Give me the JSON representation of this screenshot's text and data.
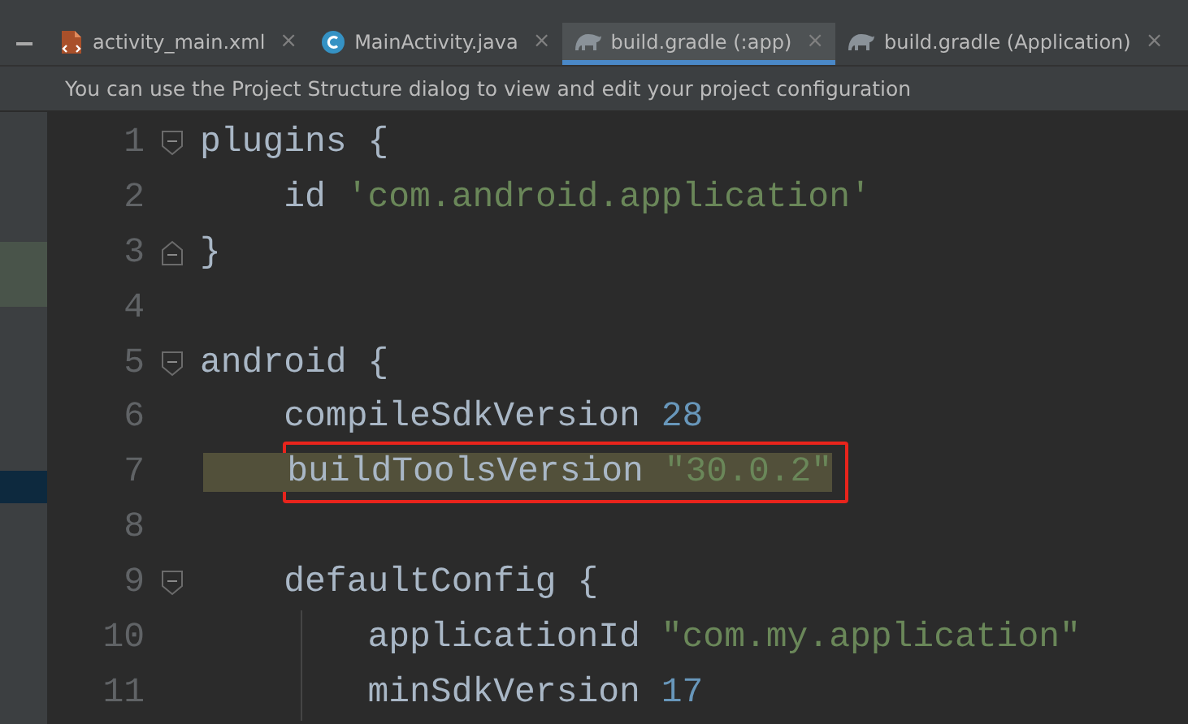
{
  "tabs": [
    {
      "label": "activity_main.xml",
      "kind": "xml",
      "close": "×",
      "selected": false
    },
    {
      "label": "MainActivity.java",
      "kind": "class",
      "close": "×",
      "selected": false
    },
    {
      "label": "build.gradle (:app)",
      "kind": "gradle",
      "close": "×",
      "selected": true
    },
    {
      "label": "build.gradle (Application)",
      "kind": "gradle",
      "close": "×",
      "selected": false
    }
  ],
  "notice": "You can use the Project Structure dialog to view and edit your project configuration",
  "lines": [
    {
      "number": "1",
      "fold_start": true,
      "tokens": [
        {
          "kind": "plain",
          "text": "plugins {"
        }
      ]
    },
    {
      "number": "2",
      "tokens": [
        {
          "kind": "plain",
          "text": "    id "
        },
        {
          "kind": "string",
          "text": "'com.android.application'"
        }
      ]
    },
    {
      "number": "3",
      "fold_end": true,
      "tokens": [
        {
          "kind": "plain",
          "text": "}"
        }
      ]
    },
    {
      "number": "4"
    },
    {
      "number": "5",
      "fold_start": true,
      "tokens": [
        {
          "kind": "plain",
          "text": "android {"
        }
      ]
    },
    {
      "number": "6",
      "tokens": [
        {
          "kind": "plain",
          "text": "    compileSdkVersion "
        },
        {
          "kind": "number",
          "text": "28"
        }
      ]
    },
    {
      "number": "7",
      "highlighted": true,
      "boxed": true,
      "tokens": [
        {
          "kind": "plain",
          "text": "    buildToolsVersion "
        },
        {
          "kind": "string",
          "text": "\"30.0.2\""
        }
      ]
    },
    {
      "number": "8"
    },
    {
      "number": "9",
      "fold_start": true,
      "tokens": [
        {
          "kind": "plain",
          "text": "    defaultConfig {"
        }
      ]
    },
    {
      "number": "10",
      "guide": true,
      "tokens": [
        {
          "kind": "plain",
          "text": "        applicationId "
        },
        {
          "kind": "string",
          "text": "\"com.my.application\""
        }
      ]
    },
    {
      "number": "11",
      "guide": true,
      "tokens": [
        {
          "kind": "plain",
          "text": "        minSdkVersion "
        },
        {
          "kind": "number",
          "text": "17"
        }
      ]
    }
  ]
}
